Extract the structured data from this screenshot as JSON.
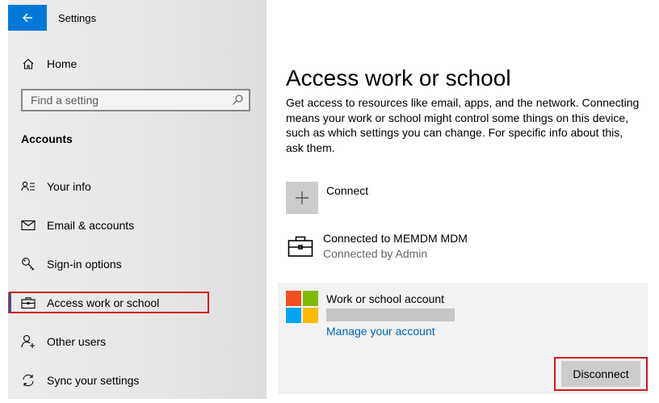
{
  "window": {
    "title": "Settings",
    "accent_color": "#0078d7"
  },
  "sidebar": {
    "home_label": "Home",
    "search_placeholder": "Find a setting",
    "section_title": "Accounts",
    "items": [
      {
        "label": "Your info",
        "icon": "person-card-icon"
      },
      {
        "label": "Email & accounts",
        "icon": "mail-icon"
      },
      {
        "label": "Sign-in options",
        "icon": "key-icon"
      },
      {
        "label": "Access work or school",
        "icon": "briefcase-icon",
        "selected": true
      },
      {
        "label": "Other users",
        "icon": "person-add-icon"
      },
      {
        "label": "Sync your settings",
        "icon": "sync-icon"
      }
    ]
  },
  "main": {
    "title": "Access work or school",
    "description": "Get access to resources like email, apps, and the network. Connecting means your work or school might control some things on this device, such as which settings you can change. For specific info about this, ask them.",
    "connect_label": "Connect",
    "mdm": {
      "title": "Connected to MEMDM MDM",
      "subtitle": "Connected by Admin"
    },
    "account": {
      "title": "Work or school account",
      "manage_link": "Manage your account",
      "disconnect_label": "Disconnect"
    }
  },
  "highlight_color": "#d11a1a",
  "link_color": "#0067b8"
}
